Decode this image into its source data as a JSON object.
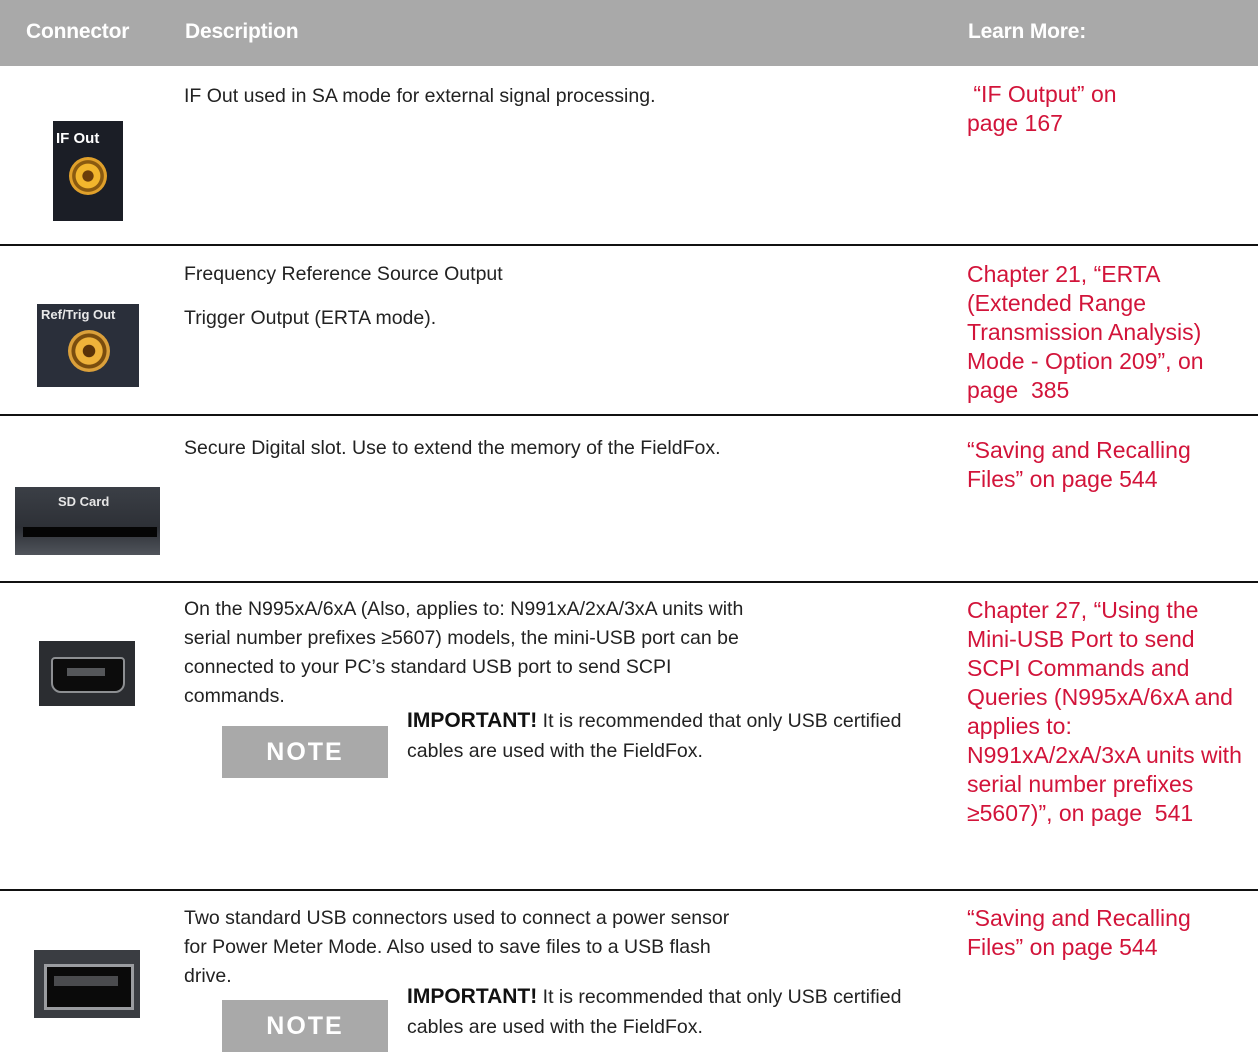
{
  "headers": {
    "connector": "Connector",
    "description": "Description",
    "learn_more": "Learn More:"
  },
  "rows": [
    {
      "image_label": "IF Out",
      "description": [
        "IF Out used in SA mode for external signal processing."
      ],
      "learn_more": " “IF Output” on page 167"
    },
    {
      "image_label": "Ref/Trig Out",
      "description": [
        "Frequency Reference Source Output",
        "Trigger Output (ERTA mode)."
      ],
      "learn_more": "Chapter 21, “ERTA (Extended Range Transmission Analysis) Mode - Option 209”, on page  385"
    },
    {
      "image_label": "SD Card",
      "description": [
        "Secure Digital slot. Use to extend the memory of the FieldFox."
      ],
      "learn_more": "“Saving and Recalling Files” on page 544"
    },
    {
      "image_label": "",
      "description": [
        "On the N995xA/6xA (Also, applies to: N991xA/2xA/3xA units with serial number prefixes ≥5607) models, the mini-USB port can be connected to your PC’s standard USB port to send SCPI commands."
      ],
      "note": {
        "label": "NOTE",
        "bold": "IMPORTANT!",
        "text": " It is recommended that only USB certified cables are used with the FieldFox."
      },
      "learn_more": "Chapter 27, “Using the Mini-USB Port to send SCPI Commands and Queries (N995xA/6xA and applies to: N991xA/2xA/3xA units with serial number prefixes ≥5607)”, on page  541"
    },
    {
      "image_label": "",
      "description": [
        "Two standard USB connectors used to connect a power sensor for Power Meter Mode. Also used to save files to a USB flash drive."
      ],
      "note": {
        "label": "NOTE",
        "bold": "IMPORTANT!",
        "text": " It is recommended that only USB certified cables are used with the FieldFox."
      },
      "learn_more": "“Saving and Recalling Files” on page 544"
    }
  ]
}
